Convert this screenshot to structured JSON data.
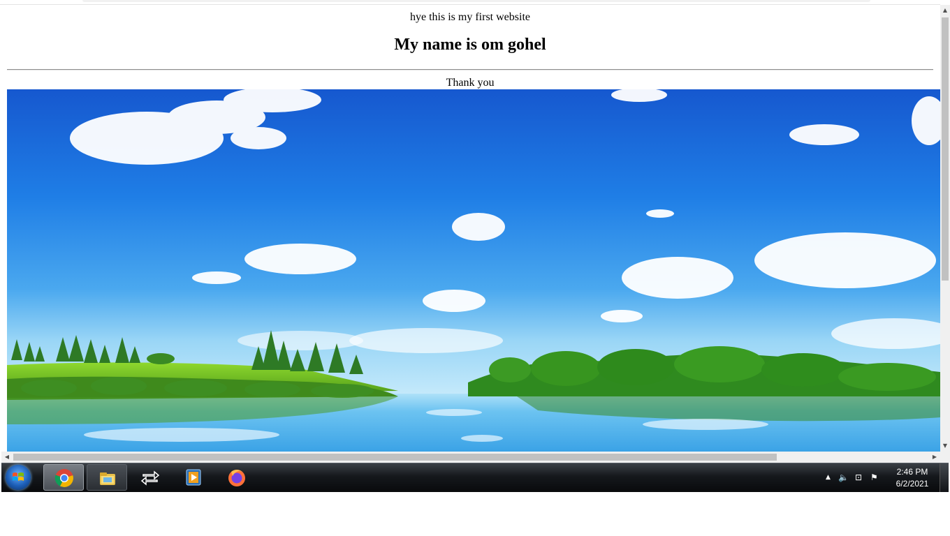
{
  "page": {
    "intro_text": "hye this is my first website",
    "heading": "My name is om gohel",
    "closing_text": "Thank you"
  },
  "taskbar": {
    "apps": [
      "chrome-icon",
      "file-explorer-icon",
      "switch-windows-icon",
      "media-player-icon",
      "firefox-icon"
    ],
    "clock_time": "2:46 PM",
    "clock_date": "6/2/2021"
  },
  "colors": {
    "sky_top": "#1a64d6",
    "sky_horizon": "#8fd0f5",
    "grass": "#7cc527",
    "water": "#5fb9ee"
  }
}
